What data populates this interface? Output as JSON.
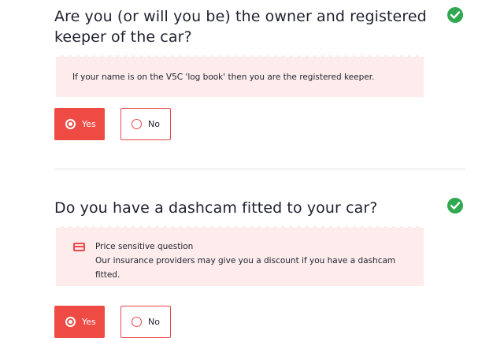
{
  "question1": {
    "title": "Are you (or will you be) the owner and registered keeper of the car?",
    "hint": "If your name is on the V5C 'log book' then you are the registered keeper.",
    "options": {
      "yes": "Yes",
      "no": "No"
    },
    "selected": "yes",
    "status_icon": "check-circle-icon"
  },
  "question2": {
    "title": "Do you have a dashcam fitted to your car?",
    "hint_heading": "Price sensitive question",
    "hint_body": "Our insurance providers may give you a discount if you have a dashcam fitted.",
    "hint_icon": "credit-card-icon",
    "options": {
      "yes": "Yes",
      "no": "No"
    },
    "selected": "yes",
    "status_icon": "check-circle-icon"
  },
  "colors": {
    "accent": "#ee4b45",
    "hint_background": "#fdeceb",
    "success": "#2fa84f"
  }
}
